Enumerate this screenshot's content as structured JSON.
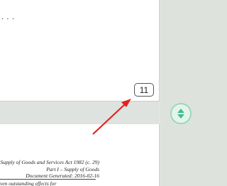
{
  "page": {
    "top_ellipsis": ". . .",
    "page_number": "11",
    "footer": {
      "line1": "Supply of Goods and Services Act 1982 (c. 29)",
      "line2": "Part I – Supply of Goods",
      "line3": "Document Generated: 2016-02-16",
      "note": "ven outstanding effects for"
    }
  },
  "controls": {
    "scroll_button_icon": "up-down-arrows-icon"
  },
  "annotation": {
    "arrow_color": "#e0231f"
  }
}
